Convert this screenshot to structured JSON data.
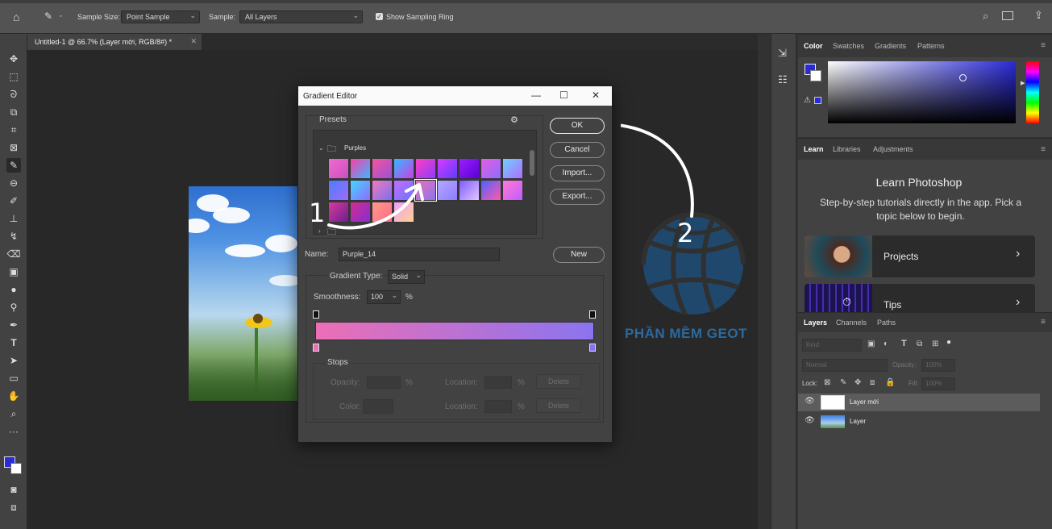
{
  "optbar": {
    "sample_size_label": "Sample Size:",
    "sample_size_value": "Point Sample",
    "sample_label": "Sample:",
    "sample_value": "All Layers",
    "show_ring_label": "Show Sampling Ring"
  },
  "document": {
    "tab_title": "Untitled-1 @ 66.7% (Layer mới, RGB/8#) *"
  },
  "dialog": {
    "title": "Gradient Editor",
    "presets_label": "Presets",
    "folder_name": "Purples",
    "ok_label": "OK",
    "cancel_label": "Cancel",
    "import_label": "Import...",
    "export_label": "Export...",
    "name_label": "Name:",
    "name_value": "Purple_14",
    "new_label": "New",
    "gradient_type_label": "Gradient Type:",
    "gradient_type_value": "Solid",
    "smoothness_label": "Smoothness:",
    "smoothness_value": "100",
    "percent": "%",
    "stops_label": "Stops",
    "opacity_label": "Opacity:",
    "location_label": "Location:",
    "color_label": "Color:",
    "delete_label": "Delete",
    "gradient_start_color": "#ec6fb5",
    "gradient_end_color": "#8b74f0"
  },
  "annotations": {
    "step1": "1",
    "step2": "2",
    "watermark": "PHẦN MỀM GEOT"
  },
  "color_panel": {
    "tabs": [
      "Color",
      "Swatches",
      "Gradients",
      "Patterns"
    ],
    "base_hue": "#2a2ad8"
  },
  "learn_panel": {
    "tabs": [
      "Learn",
      "Libraries",
      "Adjustments"
    ],
    "title": "Learn Photoshop",
    "description": "Step-by-step tutorials directly in the app. Pick a topic below to begin.",
    "cards": [
      "Projects",
      "Tips"
    ]
  },
  "layers_panel": {
    "tabs": [
      "Layers",
      "Channels",
      "Paths"
    ],
    "kind_placeholder": "Kind",
    "blend_mode": "Normal",
    "opacity_label": "Opacity:",
    "opacity_value": "100%",
    "lock_label": "Lock:",
    "fill_label": "Fill:",
    "fill_value": "100%",
    "layers": [
      "Layer mới",
      "Layer"
    ]
  },
  "swatch_colors": [
    "linear-gradient(135deg,#f36ad0,#c850c0)",
    "linear-gradient(135deg,#fa3ea8,#3fb7ff)",
    "linear-gradient(135deg,#f5539e,#9b52d6)",
    "linear-gradient(135deg,#35b8ff,#cb3fe5)",
    "linear-gradient(135deg,#ff3fc0,#8c3cff)",
    "linear-gradient(135deg,#d93cff,#5c3cff)",
    "linear-gradient(135deg,#9c1fff,#5a00d6)",
    "linear-gradient(135deg,#e55de0,#8d6dff)",
    "linear-gradient(135deg,#6bd1ff,#b26cff)",
    "linear-gradient(135deg,#4f7cff,#9c6cff)",
    "linear-gradient(135deg,#44d7ff,#8e6bff)",
    "linear-gradient(135deg,#f27bbc,#7d6ef0)",
    "linear-gradient(135deg,#c26cff,#6e74ff)",
    "linear-gradient(135deg,#ec6fb5,#8b74f0)",
    "linear-gradient(135deg,#b4a7ff,#8f7cff)",
    "linear-gradient(135deg,#7c5cff,#e2c6ff)",
    "linear-gradient(135deg,#4e61ff,#ff5ba8)",
    "linear-gradient(135deg,#ff7bd1,#c25cff)",
    "linear-gradient(135deg,#d93a9e,#6b1f8e)",
    "linear-gradient(135deg,#d02f8f,#8a2bd0)",
    "linear-gradient(135deg,#ff9a8b,#ff6a88)",
    "linear-gradient(135deg,#f0a0ff,#ffd38c)"
  ]
}
